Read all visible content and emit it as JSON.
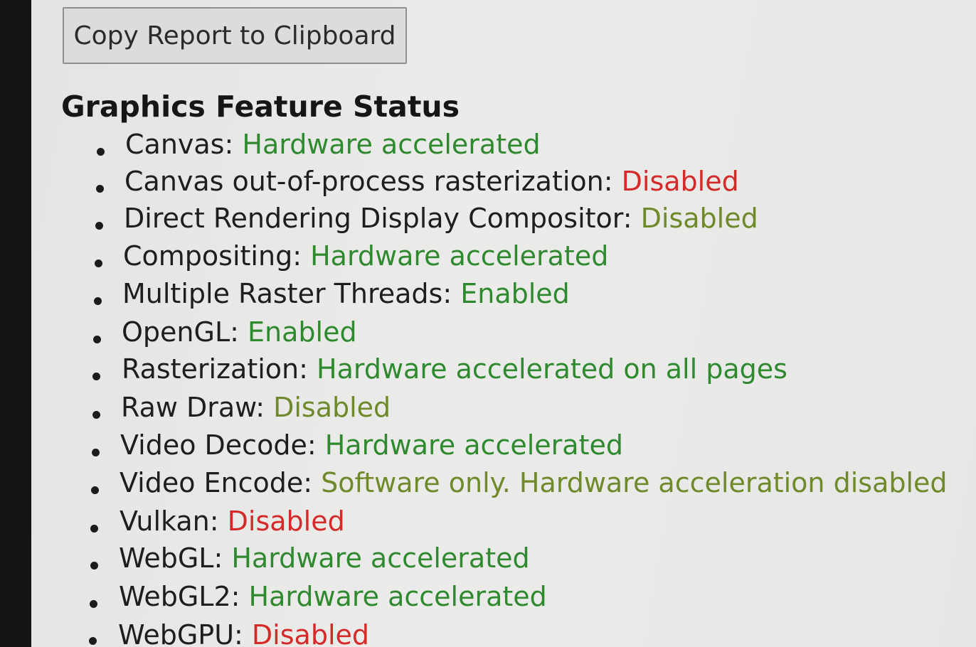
{
  "toolbar": {
    "copy_report_label": "Copy Report to Clipboard"
  },
  "section": {
    "title": "Graphics Feature Status"
  },
  "status_colors": {
    "green": "#2f8a2f",
    "olive": "#6e8a2a",
    "red": "#d42a2a"
  },
  "features": [
    {
      "name": "Canvas",
      "status": "Hardware accelerated",
      "color": "green"
    },
    {
      "name": "Canvas out-of-process rasterization",
      "status": "Disabled",
      "color": "red"
    },
    {
      "name": "Direct Rendering Display Compositor",
      "status": "Disabled",
      "color": "olive"
    },
    {
      "name": "Compositing",
      "status": "Hardware accelerated",
      "color": "green"
    },
    {
      "name": "Multiple Raster Threads",
      "status": "Enabled",
      "color": "green"
    },
    {
      "name": "OpenGL",
      "status": "Enabled",
      "color": "green"
    },
    {
      "name": "Rasterization",
      "status": "Hardware accelerated on all pages",
      "color": "green"
    },
    {
      "name": "Raw Draw",
      "status": "Disabled",
      "color": "olive"
    },
    {
      "name": "Video Decode",
      "status": "Hardware accelerated",
      "color": "green"
    },
    {
      "name": "Video Encode",
      "status": "Software only. Hardware acceleration disabled",
      "color": "olive"
    },
    {
      "name": "Vulkan",
      "status": "Disabled",
      "color": "red"
    },
    {
      "name": "WebGL",
      "status": "Hardware accelerated",
      "color": "green"
    },
    {
      "name": "WebGL2",
      "status": "Hardware accelerated",
      "color": "green"
    },
    {
      "name": "WebGPU",
      "status": "Disabled",
      "color": "red"
    }
  ]
}
